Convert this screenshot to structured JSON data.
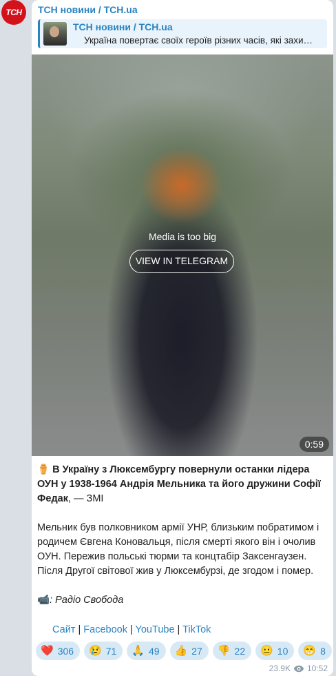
{
  "channel": {
    "avatar_text": "ТСН",
    "name": "ТСН новини / ТСН.ua"
  },
  "reply": {
    "title": "ТСН новини / ТСН.ua",
    "text": "Україна повертає своїх героїв різних часів, які захи…"
  },
  "media": {
    "notice": "Media is too big",
    "button": "VIEW IN TELEGRAM",
    "duration": "0:59"
  },
  "post": {
    "headline_emoji": "⚱️",
    "headline_bold": "В Україну з Люксембургу повернули останки лідера ОУН у 1938-1964 Андрія Мельника та його дружини Софії Федак",
    "headline_rest": ", — ЗМІ",
    "paragraph": "Мельник був полковником армії УНР, близьким побратимом і родичем Євгена Коновальця, після смерті якого він і очолив ОУН. Пережив польські тюрми та концтабір Заксенгаузен. Після Другої світової жив у Люксембурзі, де згодом і помер.",
    "source_emoji": "📹",
    "source": ": Радіо Свобода"
  },
  "links": [
    {
      "label": "Сайт"
    },
    {
      "label": "Facebook"
    },
    {
      "label": "YouTube"
    },
    {
      "label": "TikTok"
    }
  ],
  "link_separator": " | ",
  "reactions": [
    {
      "icon": "❤️",
      "count": "306"
    },
    {
      "icon": "😢",
      "count": "71"
    },
    {
      "icon": "🙏",
      "count": "49"
    },
    {
      "icon": "👍",
      "count": "27"
    },
    {
      "icon": "👎",
      "count": "22"
    },
    {
      "icon": "😐",
      "count": "10"
    },
    {
      "icon": "😁",
      "count": "8"
    }
  ],
  "meta": {
    "views": "23.9K",
    "time": "10:52"
  },
  "colors": {
    "accent": "#2a83c1",
    "brand_red": "#d4121c",
    "reaction_bg": "#d8e9f6"
  }
}
